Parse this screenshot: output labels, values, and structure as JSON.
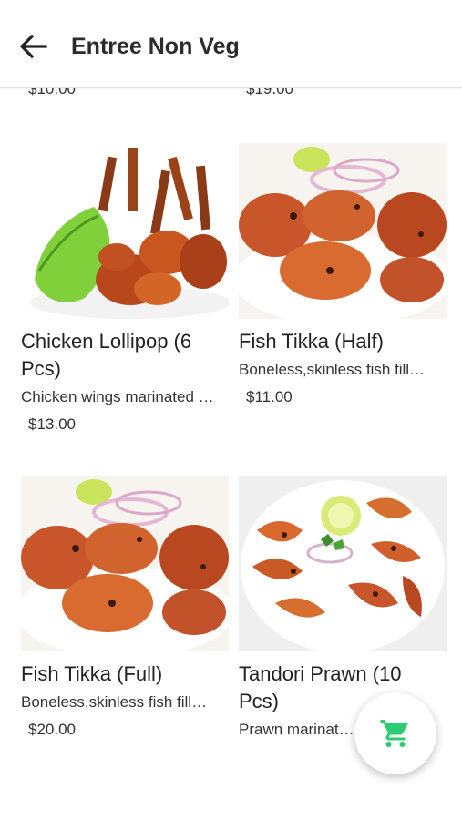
{
  "header": {
    "title": "Entree Non Veg"
  },
  "prev_row_prices": [
    "$10.00",
    "$19.00"
  ],
  "items": [
    {
      "name": "Chicken Lollipop (6 Pcs)",
      "desc": "Chicken wings marinated …",
      "price": "$13.00"
    },
    {
      "name": "Fish Tikka (Half)",
      "desc": "Boneless,skinless fish fill…",
      "price": "$11.00"
    },
    {
      "name": "Fish Tikka (Full)",
      "desc": "Boneless,skinless fish fill…",
      "price": "$20.00"
    },
    {
      "name": "Tandori Prawn (10 Pcs)",
      "desc": "Prawn marinated …",
      "price": ""
    }
  ],
  "colors": {
    "accent": "#2ecc71",
    "title": "#2b2b2b"
  },
  "icons": {
    "back": "arrow-left-icon",
    "cart": "cart-icon"
  }
}
